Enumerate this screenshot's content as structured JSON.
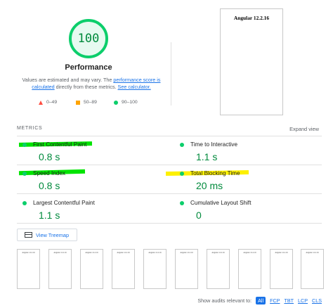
{
  "summary": {
    "score": "100",
    "title": "Performance",
    "desc_prefix": "Values are estimated and may vary. The ",
    "desc_link1": "performance score is calculated",
    "desc_middle": " directly from these metrics. ",
    "desc_link2": "See calculator.",
    "legend": {
      "fail": "0–49",
      "average": "50–89",
      "pass": "90–100"
    },
    "colors": {
      "pass": "#0cce6b",
      "average": "#ffa400",
      "fail": "#ff4e42"
    }
  },
  "final_screenshot": {
    "title": "Angular 12.2.16"
  },
  "metrics": {
    "heading": "METRICS",
    "expand_label": "Expand view",
    "items": [
      {
        "label": "First Contentful Paint",
        "value": "0.8 s"
      },
      {
        "label": "Time to Interactive",
        "value": "1.1 s"
      },
      {
        "label": "Speed Index",
        "value": "0.8 s"
      },
      {
        "label": "Total Blocking Time",
        "value": "20 ms"
      },
      {
        "label": "Largest Contentful Paint",
        "value": "1.1 s"
      },
      {
        "label": "Cumulative Layout Shift",
        "value": "0"
      }
    ]
  },
  "treemap": {
    "label": "View Treemap"
  },
  "filmstrip": {
    "frame_title": "Angular 12.2.16"
  },
  "audits_filter": {
    "label": "Show audits relevant to:",
    "options": [
      "All",
      "FCP",
      "TBT",
      "LCP",
      "CLS"
    ]
  }
}
